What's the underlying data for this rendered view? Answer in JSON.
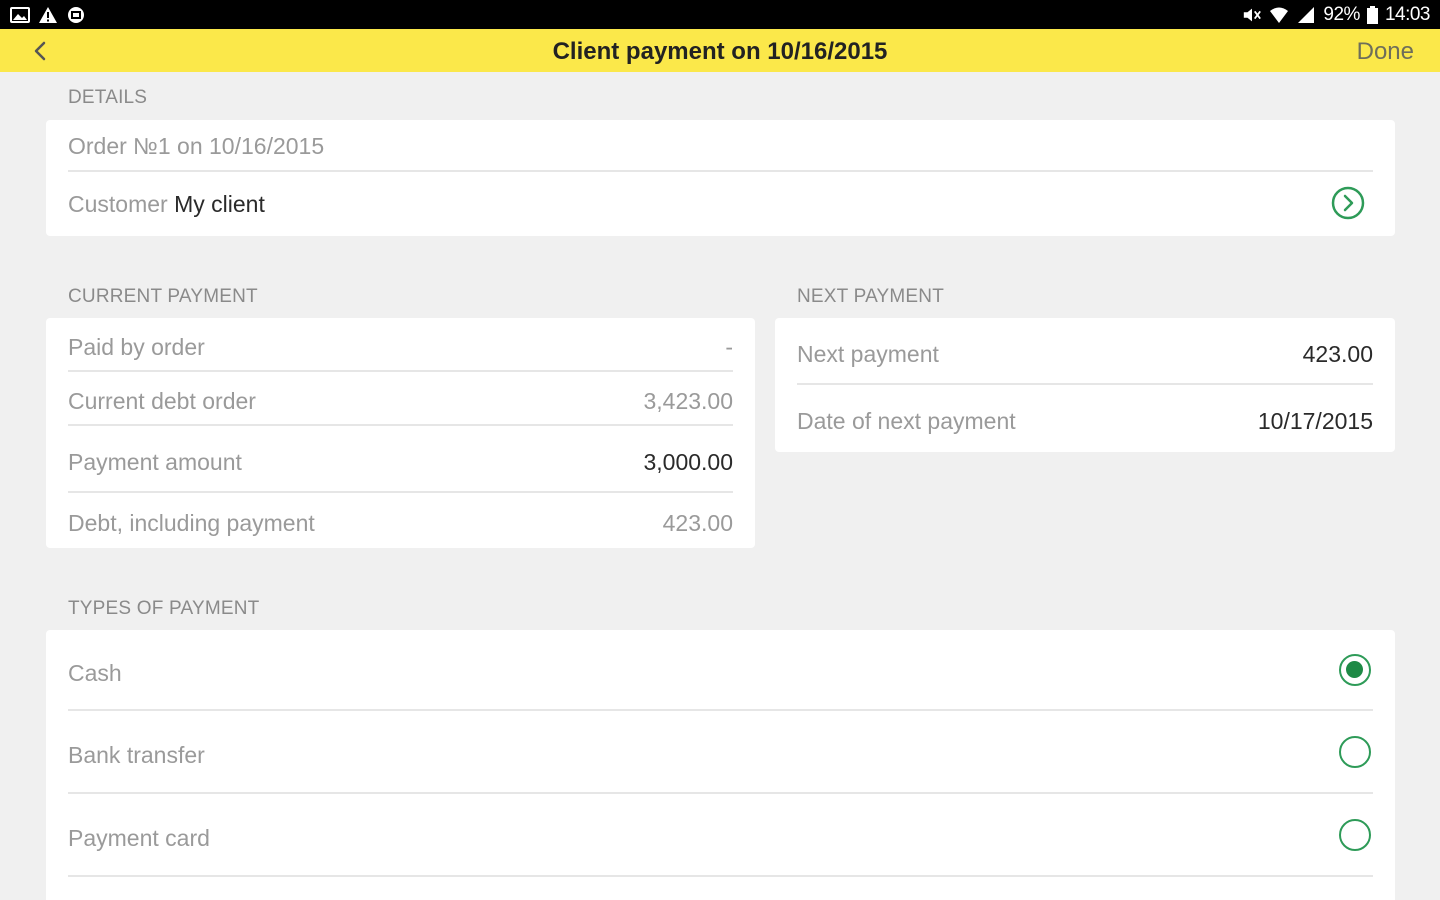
{
  "status_bar": {
    "left_icons": [
      "gallery-icon",
      "warning-icon",
      "app-icon"
    ],
    "right_icons": [
      "mute-icon",
      "wifi-icon",
      "signal-icon"
    ],
    "battery": "92%",
    "time": "14:03"
  },
  "toolbar": {
    "title": "Client payment on 10/16/2015",
    "done_label": "Done",
    "accent_color": "#fbe84a"
  },
  "details": {
    "header": "DETAILS",
    "order": "Order №1 on 10/16/2015",
    "customer_label": "Customer",
    "customer_value": "My client"
  },
  "current_payment": {
    "header": "CURRENT PAYMENT",
    "rows": [
      {
        "label": "Paid by order",
        "value": "-"
      },
      {
        "label": "Current debt order",
        "value": "3,423.00"
      },
      {
        "label": "Payment amount",
        "value": "3,000.00"
      },
      {
        "label": "Debt, including payment",
        "value": "423.00"
      }
    ]
  },
  "next_payment": {
    "header": "NEXT PAYMENT",
    "rows": [
      {
        "label": "Next payment",
        "value": "423.00"
      },
      {
        "label": "Date of next payment",
        "value": "10/17/2015"
      }
    ]
  },
  "types_of_payment": {
    "header": "TYPES OF PAYMENT",
    "options": [
      {
        "label": "Cash",
        "selected": true
      },
      {
        "label": "Bank transfer",
        "selected": false
      },
      {
        "label": "Payment card",
        "selected": false
      }
    ],
    "radio_color": "#2e9b58"
  }
}
